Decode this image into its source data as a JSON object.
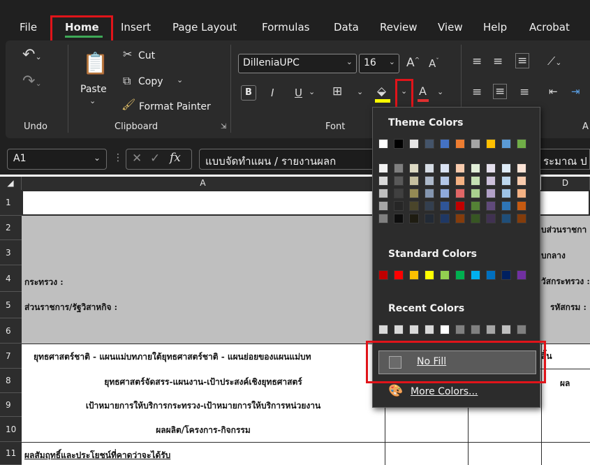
{
  "ribbon": {
    "tabs": [
      {
        "label": "File"
      },
      {
        "label": "Home"
      },
      {
        "label": "Insert"
      },
      {
        "label": "Page Layout"
      },
      {
        "label": "Formulas"
      },
      {
        "label": "Data"
      },
      {
        "label": "Review"
      },
      {
        "label": "View"
      },
      {
        "label": "Help"
      },
      {
        "label": "Acrobat"
      }
    ],
    "active_tab": "Home",
    "accent_color": "#3ea957",
    "highlight_color": "#e0141a",
    "clipboard": {
      "paste_label": "Paste",
      "cut_label": "Cut",
      "copy_label": "Copy",
      "format_painter_label": "Format Painter"
    },
    "font": {
      "font_name": "DilleniaUPC",
      "font_size": "16",
      "bold": "B",
      "italic": "I",
      "underline": "U",
      "font_color_letter": "A"
    },
    "group_labels": {
      "undo": "Undo",
      "clipboard": "Clipboard",
      "font": "Font",
      "alignment_partial": "A"
    }
  },
  "formula_bar": {
    "name_box": "A1",
    "fx": "fx",
    "formula_left": "แบบจัดทำแผน / รายงานผลก",
    "formula_right": "ระมาณ ป"
  },
  "sheet": {
    "columns": [
      "A",
      "D"
    ],
    "rows": [
      "1",
      "2",
      "3",
      "4",
      "5",
      "6",
      "7",
      "8",
      "9",
      "10",
      "11"
    ],
    "cells": {
      "a4": "กระทรวง :",
      "a5": "ส่วนราชการ/รัฐวิสาหกิจ  :",
      "a7": "ยุทธศาสตร์ชาติ - แผนแม่บทภายใต้ยุทธศาสตร์ชาติ - แผนย่อยของแผนแม่บท",
      "a8": "ยุทธศาสตร์จัดสรร-แผนงาน-เป้าประสงค์เชิงยุทธศาสตร์",
      "a9": "เป้าหมายการให้บริการกระทรวง-เป้าหมายการให้บริการหน่วยงาน",
      "a10": "ผลผลิต/โครงการ-กิจกรรม",
      "a11": "ผลสัมฤทธิ์และประโยชน์ที่คาดว่าจะได้รับ",
      "d2": "บส่วนราชกา",
      "d3": "บกลาง",
      "d4": "วัสกระทรวง :",
      "d5": "รหัสกรม :",
      "d7": "สิ้น",
      "d8": "ผล"
    }
  },
  "fill_dropdown": {
    "theme_heading": "Theme Colors",
    "standard_heading": "Standard Colors",
    "recent_heading": "Recent Colors",
    "no_fill_label": "No Fill",
    "more_colors_label": "More Colors...",
    "theme_top": [
      "#ffffff",
      "#000000",
      "#e7e6e6",
      "#44546a",
      "#4472c4",
      "#ed7d31",
      "#a5a5a5",
      "#ffc000",
      "#5b9bd5",
      "#70ad47"
    ],
    "theme_columns": [
      [
        "#f2f2f2",
        "#d9d9d9",
        "#bfbfbf",
        "#a6a6a6",
        "#808080"
      ],
      [
        "#7f7f7f",
        "#595959",
        "#404040",
        "#262626",
        "#0d0d0d"
      ],
      [
        "#dddac4",
        "#c6c0a0",
        "#948a54",
        "#4a452a",
        "#1e1c11"
      ],
      [
        "#d6dce4",
        "#adb9ca",
        "#8496b0",
        "#333f4f",
        "#222a35"
      ],
      [
        "#dae3f3",
        "#b4c7e7",
        "#8faadc",
        "#2f5597",
        "#1f3864"
      ],
      [
        "#f8cbad",
        "#f4b183",
        "#e06666",
        "#c00000",
        "#843c0c"
      ],
      [
        "#e2efd9",
        "#c5e0b3",
        "#a9d08e",
        "#548235",
        "#375623"
      ],
      [
        "#e4dfec",
        "#ccc0da",
        "#b1a0c7",
        "#604a7b",
        "#403151"
      ],
      [
        "#deebf7",
        "#bdd7ee",
        "#9dc3e6",
        "#2e75b6",
        "#1f4e79"
      ],
      [
        "#fce4d6",
        "#f8cbad",
        "#f4b183",
        "#c55a11",
        "#833c0b"
      ]
    ],
    "standard": [
      "#c00000",
      "#ff0000",
      "#ffc000",
      "#ffff00",
      "#92d050",
      "#00b050",
      "#00b0f0",
      "#0070c0",
      "#002060",
      "#7030a0"
    ],
    "recent": [
      "#d9d9d9",
      "#d9d9d9",
      "#d9d9d9",
      "#d9d9d9",
      "#ffffff",
      "#808080",
      "#808080",
      "#a6a6a6",
      "#bfbfbf",
      "#808080"
    ]
  }
}
